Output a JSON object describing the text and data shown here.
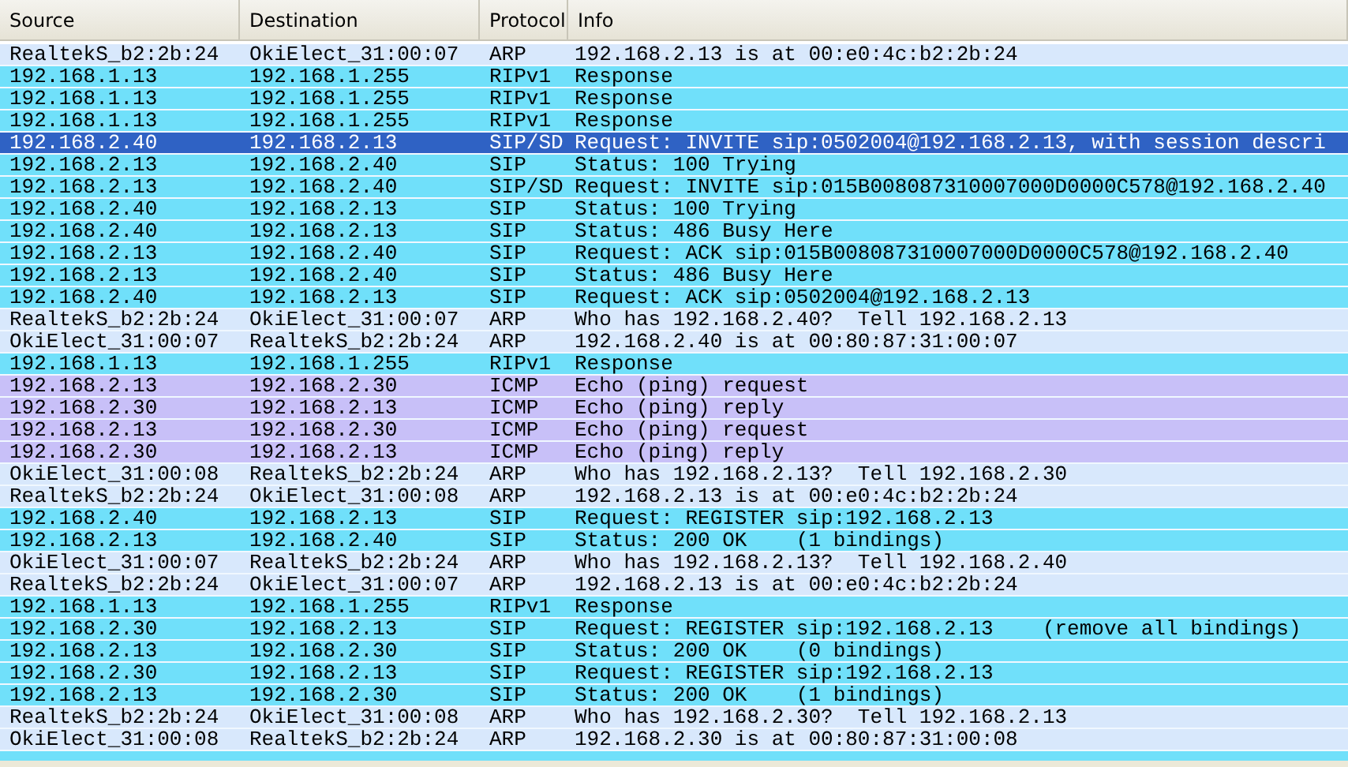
{
  "table": {
    "columns": [
      "Source",
      "Destination",
      "Protocol",
      "Info"
    ],
    "rows": [
      {
        "cells": [
          "RealtekS_b2:2b:24",
          "OkiElect_31:00:07",
          "ARP",
          "192.168.2.13 is at 00:e0:4c:b2:2b:24"
        ],
        "color": "#d8e8fc",
        "selected": false
      },
      {
        "cells": [
          "192.168.1.13",
          "192.168.1.255",
          "RIPv1",
          "Response"
        ],
        "color": "#70e0fa",
        "selected": false
      },
      {
        "cells": [
          "192.168.1.13",
          "192.168.1.255",
          "RIPv1",
          "Response"
        ],
        "color": "#70e0fa",
        "selected": false
      },
      {
        "cells": [
          "192.168.1.13",
          "192.168.1.255",
          "RIPv1",
          "Response"
        ],
        "color": "#70e0fa",
        "selected": false
      },
      {
        "cells": [
          "192.168.2.40",
          "192.168.2.13",
          "SIP/SD",
          "Request: INVITE sip:0502004@192.168.2.13, with session descri"
        ],
        "selected": true
      },
      {
        "cells": [
          "192.168.2.13",
          "192.168.2.40",
          "SIP",
          "Status: 100 Trying"
        ],
        "color": "#70e0fa",
        "selected": false
      },
      {
        "cells": [
          "192.168.2.13",
          "192.168.2.40",
          "SIP/SD",
          "Request: INVITE sip:015B008087310007000D0000C578@192.168.2.40"
        ],
        "color": "#70e0fa",
        "selected": false
      },
      {
        "cells": [
          "192.168.2.40",
          "192.168.2.13",
          "SIP",
          "Status: 100 Trying"
        ],
        "color": "#70e0fa",
        "selected": false
      },
      {
        "cells": [
          "192.168.2.40",
          "192.168.2.13",
          "SIP",
          "Status: 486 Busy Here"
        ],
        "color": "#70e0fa",
        "selected": false
      },
      {
        "cells": [
          "192.168.2.13",
          "192.168.2.40",
          "SIP",
          "Request: ACK sip:015B008087310007000D0000C578@192.168.2.40"
        ],
        "color": "#70e0fa",
        "selected": false
      },
      {
        "cells": [
          "192.168.2.13",
          "192.168.2.40",
          "SIP",
          "Status: 486 Busy Here"
        ],
        "color": "#70e0fa",
        "selected": false
      },
      {
        "cells": [
          "192.168.2.40",
          "192.168.2.13",
          "SIP",
          "Request: ACK sip:0502004@192.168.2.13"
        ],
        "color": "#70e0fa",
        "selected": false
      },
      {
        "cells": [
          "RealtekS_b2:2b:24",
          "OkiElect_31:00:07",
          "ARP",
          "Who has 192.168.2.40?  Tell 192.168.2.13"
        ],
        "color": "#d8e8fc",
        "selected": false
      },
      {
        "cells": [
          "OkiElect_31:00:07",
          "RealtekS_b2:2b:24",
          "ARP",
          "192.168.2.40 is at 00:80:87:31:00:07"
        ],
        "color": "#d8e8fc",
        "selected": false
      },
      {
        "cells": [
          "192.168.1.13",
          "192.168.1.255",
          "RIPv1",
          "Response"
        ],
        "color": "#70e0fa",
        "selected": false
      },
      {
        "cells": [
          "192.168.2.13",
          "192.168.2.30",
          "ICMP",
          "Echo (ping) request"
        ],
        "color": "#c8c0f8",
        "selected": false
      },
      {
        "cells": [
          "192.168.2.30",
          "192.168.2.13",
          "ICMP",
          "Echo (ping) reply"
        ],
        "color": "#c8c0f8",
        "selected": false
      },
      {
        "cells": [
          "192.168.2.13",
          "192.168.2.30",
          "ICMP",
          "Echo (ping) request"
        ],
        "color": "#c8c0f8",
        "selected": false
      },
      {
        "cells": [
          "192.168.2.30",
          "192.168.2.13",
          "ICMP",
          "Echo (ping) reply"
        ],
        "color": "#c8c0f8",
        "selected": false
      },
      {
        "cells": [
          "OkiElect_31:00:08",
          "RealtekS_b2:2b:24",
          "ARP",
          "Who has 192.168.2.13?  Tell 192.168.2.30"
        ],
        "color": "#d8e8fc",
        "selected": false
      },
      {
        "cells": [
          "RealtekS_b2:2b:24",
          "OkiElect_31:00:08",
          "ARP",
          "192.168.2.13 is at 00:e0:4c:b2:2b:24"
        ],
        "color": "#d8e8fc",
        "selected": false
      },
      {
        "cells": [
          "192.168.2.40",
          "192.168.2.13",
          "SIP",
          "Request: REGISTER sip:192.168.2.13"
        ],
        "color": "#70e0fa",
        "selected": false
      },
      {
        "cells": [
          "192.168.2.13",
          "192.168.2.40",
          "SIP",
          "Status: 200 OK    (1 bindings)"
        ],
        "color": "#70e0fa",
        "selected": false
      },
      {
        "cells": [
          "OkiElect_31:00:07",
          "RealtekS_b2:2b:24",
          "ARP",
          "Who has 192.168.2.13?  Tell 192.168.2.40"
        ],
        "color": "#d8e8fc",
        "selected": false
      },
      {
        "cells": [
          "RealtekS_b2:2b:24",
          "OkiElect_31:00:07",
          "ARP",
          "192.168.2.13 is at 00:e0:4c:b2:2b:24"
        ],
        "color": "#d8e8fc",
        "selected": false
      },
      {
        "cells": [
          "192.168.1.13",
          "192.168.1.255",
          "RIPv1",
          "Response"
        ],
        "color": "#70e0fa",
        "selected": false
      },
      {
        "cells": [
          "192.168.2.30",
          "192.168.2.13",
          "SIP",
          "Request: REGISTER sip:192.168.2.13    (remove all bindings)"
        ],
        "color": "#70e0fa",
        "selected": false
      },
      {
        "cells": [
          "192.168.2.13",
          "192.168.2.30",
          "SIP",
          "Status: 200 OK    (0 bindings)"
        ],
        "color": "#70e0fa",
        "selected": false
      },
      {
        "cells": [
          "192.168.2.30",
          "192.168.2.13",
          "SIP",
          "Request: REGISTER sip:192.168.2.13"
        ],
        "color": "#70e0fa",
        "selected": false
      },
      {
        "cells": [
          "192.168.2.13",
          "192.168.2.30",
          "SIP",
          "Status: 200 OK    (1 bindings)"
        ],
        "color": "#70e0fa",
        "selected": false
      },
      {
        "cells": [
          "RealtekS_b2:2b:24",
          "OkiElect_31:00:08",
          "ARP",
          "Who has 192.168.2.30?  Tell 192.168.2.13"
        ],
        "color": "#d8e8fc",
        "selected": false
      },
      {
        "cells": [
          "OkiElect_31:00:08",
          "RealtekS_b2:2b:24",
          "ARP",
          "192.168.2.30 is at 00:80:87:31:00:08"
        ],
        "color": "#d8e8fc",
        "selected": false
      }
    ]
  }
}
